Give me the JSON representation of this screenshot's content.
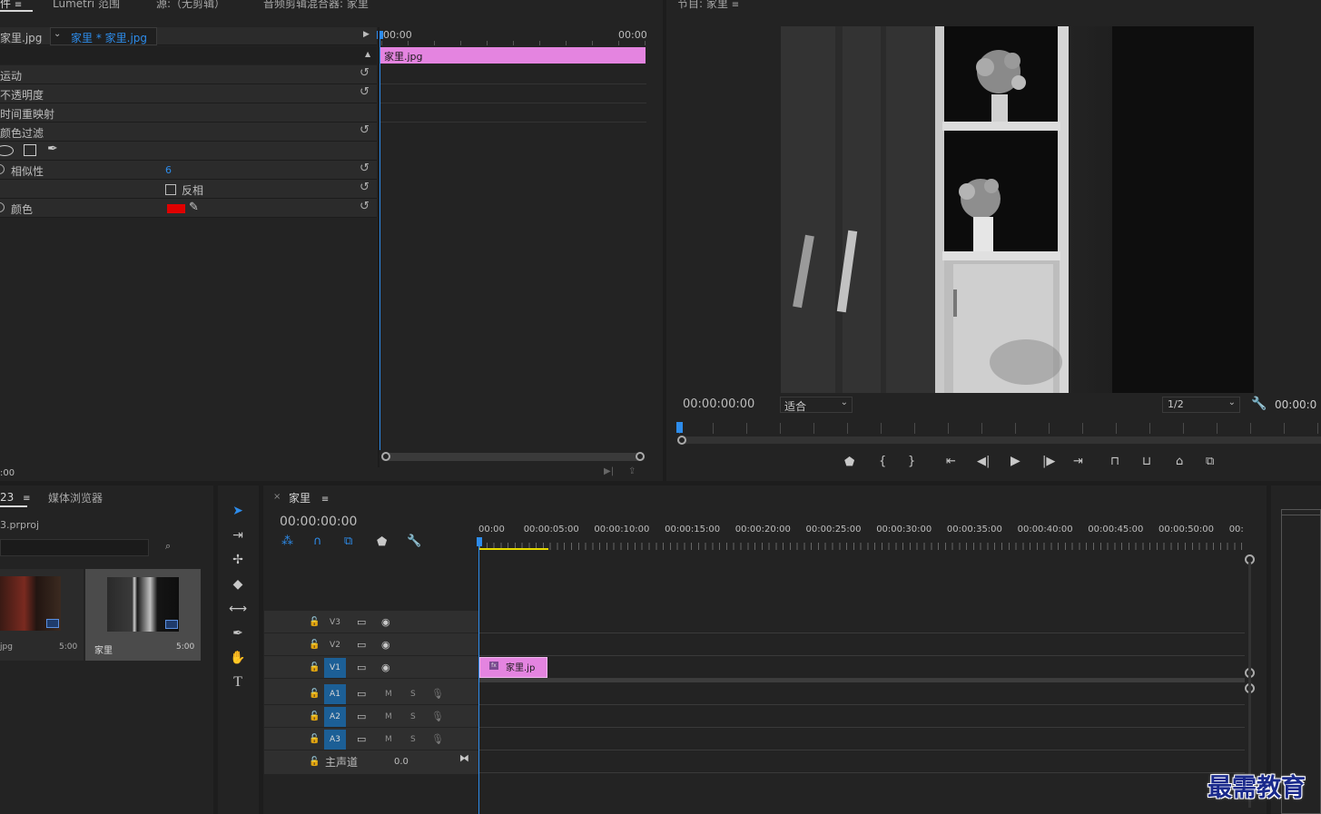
{
  "top_tabs": {
    "effect_controls": "件",
    "lumetri": "Lumetri 范围",
    "source": "源:（无剪辑）",
    "audio_mixer": "音频剪辑混合器: 家里",
    "program": "节目: 家里"
  },
  "effect_controls": {
    "clip_source": "家里.jpg",
    "clip_target": "家里 * 家里.jpg",
    "timeline_start": "00:00",
    "timeline_end": "00:00",
    "clip_bar_label": "家里.jpg",
    "rows": [
      {
        "label": "运动"
      },
      {
        "label": "不透明度"
      },
      {
        "label": "时间重映射"
      },
      {
        "label": "颜色过滤"
      }
    ],
    "similarity_label": "相似性",
    "similarity_value": "6",
    "invert_label": "反相",
    "color_label": "颜色",
    "color_swatch": "#e00000",
    "footer_time": ":00"
  },
  "program": {
    "timecode": "00:00:00:00",
    "fit_label": "适合",
    "resolution": "1/2",
    "duration": "00:00:0"
  },
  "project": {
    "tab_project": "23",
    "tab_media_browser": "媒体浏览器",
    "project_file": "3.prproj",
    "items": [
      {
        "name": "jpg",
        "duration": "5:00"
      },
      {
        "name": "家里",
        "duration": "5:00"
      }
    ]
  },
  "sequence": {
    "tab_name": "家里",
    "timecode": "00:00:00:00",
    "ruler": [
      "00:00",
      "00:00:05:00",
      "00:00:10:00",
      "00:00:15:00",
      "00:00:20:00",
      "00:00:25:00",
      "00:00:30:00",
      "00:00:35:00",
      "00:00:40:00",
      "00:00:45:00",
      "00:00:50:00",
      "00:"
    ],
    "video_tracks": [
      "V3",
      "V2",
      "V1"
    ],
    "audio_tracks": [
      "A1",
      "A2",
      "A3"
    ],
    "mute_label": "M",
    "solo_label": "S",
    "master_label": "主声道",
    "master_value": "0.0",
    "clip_label": "家里.jp",
    "clip_color": "#e484e0"
  },
  "watermark": "最需教育",
  "colors": {
    "accent_blue": "#2d8ceb",
    "clip_pink": "#e484e0",
    "track_blue": "#1c5f96"
  }
}
